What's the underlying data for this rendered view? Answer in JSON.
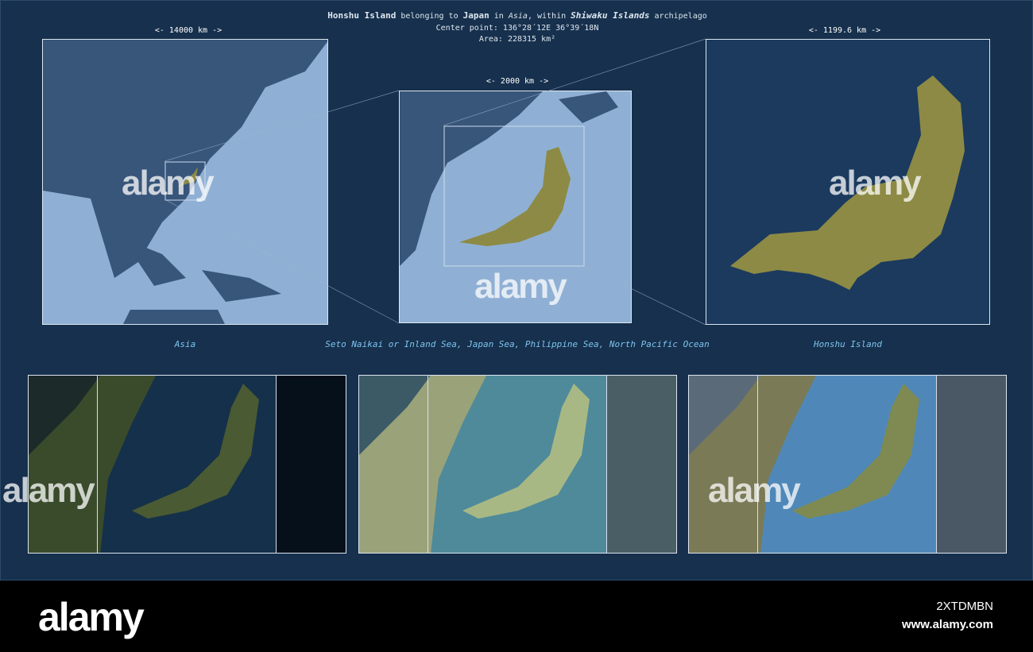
{
  "header": {
    "island": "Honshu Island",
    "t1": "belonging to",
    "country": "Japan",
    "t2": "in",
    "continent": "Asia",
    "t3": ", within",
    "archipelago": "Shiwaku Islands",
    "t4": "archipelago",
    "center": "Center point: 136°28´12E  36°39´18N",
    "area": "Area: 228315 km²"
  },
  "scales": {
    "asia": "<-   14000 km   ->",
    "region": "<-   2000 km   ->",
    "island": "<-   1199.6 km   ->"
  },
  "captions": {
    "asia": "Asia",
    "seas": "Seto Naikai or Inland Sea, Japan Sea, Philippine Sea, North Pacific Ocean",
    "island": "Honshu Island"
  },
  "watermark": "alamy",
  "banner": {
    "logo": "alamy",
    "code": "2XTDMBN",
    "url": "www.alamy.com"
  },
  "colors": {
    "background": "#16304d",
    "land_highlight": "#8d8a45",
    "ocean": "#8fb0d4"
  }
}
